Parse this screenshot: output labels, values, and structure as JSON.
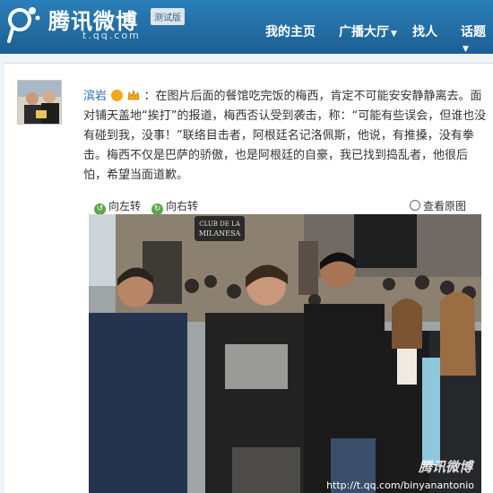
{
  "header": {
    "brand": "腾讯微博",
    "beta": "测试版",
    "domain": "t.qq.com",
    "nav": [
      {
        "label": "我的主页",
        "caret": ""
      },
      {
        "label": "广播大厅",
        "caret": "▼"
      },
      {
        "label": "找人",
        "caret": ""
      },
      {
        "label": "话题",
        "caret": "▼"
      }
    ]
  },
  "post": {
    "username": "滨岩",
    "text": "：在图片后面的餐馆吃完饭的梅西，肯定不可能安安静静离去。面对铺天盖地“挨打”的报道，梅西否认受到袭击，称：“可能有些误会，但谁也没有碰到我，没事！”联络目击者，阿根廷名记洛佩斯，他说，有推搡，没有拳击。梅西不仅是巴萨的骄傲，也是阿根廷的自豪，我已找到捣乱者，他很后怕，希望当面道歉。"
  },
  "actions": {
    "rotate_left": "向左转",
    "rotate_right": "向右转",
    "view_original": "查看原图"
  },
  "photo": {
    "sign": "CLUB DE LA MILANESA",
    "watermark": "腾讯微博",
    "watermark_url": "http://t.qq.com/binyanantonio"
  },
  "colors": {
    "header": "#1f6ba3",
    "link": "#2a6cad",
    "background": "#eef3f7"
  }
}
